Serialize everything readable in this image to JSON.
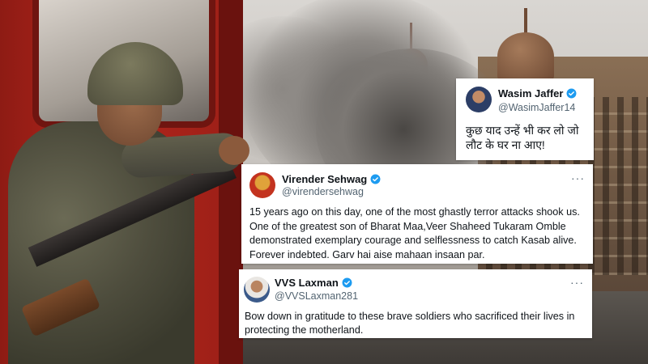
{
  "tweets": [
    {
      "name": "Wasim Jaffer",
      "handle": "@WasimJaffer14",
      "text": "कुछ याद उन्हें भी कर लो जो लौट के घर ना आए!",
      "verified": true
    },
    {
      "name": "Virender Sehwag",
      "handle": "@virendersehwag",
      "text": "15 years ago on this day, one of the most ghastly terror attacks shook us. One of the greatest son of Bharat Maa,Veer Shaheed Tukaram Omble demonstrated exemplary courage and selflessness to catch Kasab alive. Forever indebted. Garv hai aise mahaan insaan par.",
      "verified": true,
      "more": "···"
    },
    {
      "name": "VVS Laxman",
      "handle": "@VVSLaxman281",
      "text": "Bow down in gratitude to these brave soldiers who sacrificed their lives in protecting the motherland.",
      "verified": true,
      "more": "···"
    }
  ],
  "colors": {
    "verified_badge": "#1d9bf0",
    "name_text": "#0f1419",
    "handle_text": "#536471"
  },
  "icons": [
    "verified-badge-icon",
    "more-options-icon"
  ]
}
